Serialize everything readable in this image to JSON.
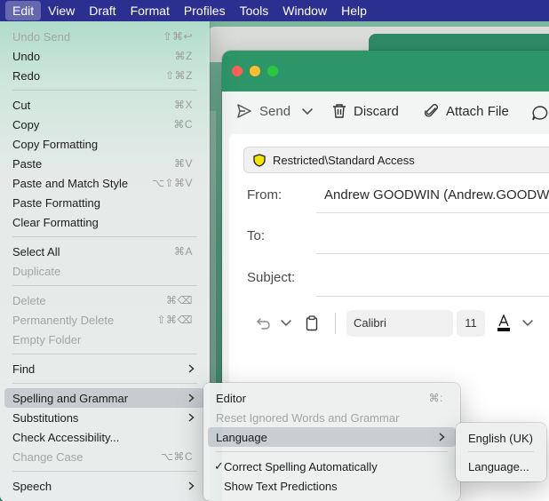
{
  "menubar": {
    "items": [
      "Edit",
      "View",
      "Draft",
      "Format",
      "Profiles",
      "Tools",
      "Window",
      "Help"
    ]
  },
  "compose": {
    "toolbar": {
      "send": "Send",
      "discard": "Discard",
      "attach": "Attach File"
    },
    "sensitivity": "Restricted\\Standard Access",
    "from_label": "From:",
    "from_value": "Andrew GOODWIN (Andrew.GOODWI",
    "to_label": "To:",
    "subject_label": "Subject:",
    "font": "Calibri",
    "font_size": "11"
  },
  "edit_menu": {
    "items": [
      {
        "label": "Undo Send",
        "shortcut": "⇧⌘↩"
      },
      {
        "label": "Undo",
        "shortcut": "⌘Z"
      },
      {
        "label": "Redo",
        "shortcut": "⇧⌘Z"
      },
      {
        "label": "Cut",
        "shortcut": "⌘X"
      },
      {
        "label": "Copy",
        "shortcut": "⌘C"
      },
      {
        "label": "Copy Formatting",
        "shortcut": ""
      },
      {
        "label": "Paste",
        "shortcut": "⌘V"
      },
      {
        "label": "Paste and Match Style",
        "shortcut": "⌥⇧⌘V"
      },
      {
        "label": "Paste Formatting",
        "shortcut": ""
      },
      {
        "label": "Clear Formatting",
        "shortcut": ""
      },
      {
        "label": "Select All",
        "shortcut": "⌘A"
      },
      {
        "label": "Duplicate",
        "shortcut": ""
      },
      {
        "label": "Delete",
        "shortcut": "⌘⌫"
      },
      {
        "label": "Permanently Delete",
        "shortcut": "⇧⌘⌫"
      },
      {
        "label": "Empty Folder",
        "shortcut": ""
      },
      {
        "label": "Find",
        "shortcut": ""
      },
      {
        "label": "Spelling and Grammar",
        "shortcut": ""
      },
      {
        "label": "Substitutions",
        "shortcut": ""
      },
      {
        "label": "Check Accessibility...",
        "shortcut": ""
      },
      {
        "label": "Change Case",
        "shortcut": "⌥⌘C"
      },
      {
        "label": "Speech",
        "shortcut": ""
      }
    ]
  },
  "spelling_menu": {
    "items": [
      {
        "label": "Editor",
        "shortcut": "⌘:"
      },
      {
        "label": "Reset Ignored Words and Grammar",
        "shortcut": ""
      },
      {
        "label": "Language",
        "shortcut": ""
      },
      {
        "label": "Correct Spelling Automatically",
        "shortcut": ""
      },
      {
        "label": "Show Text Predictions",
        "shortcut": ""
      }
    ],
    "checkmark": "✓"
  },
  "language_menu": {
    "items": [
      {
        "label": "English (UK)"
      },
      {
        "label": "Language..."
      }
    ]
  }
}
